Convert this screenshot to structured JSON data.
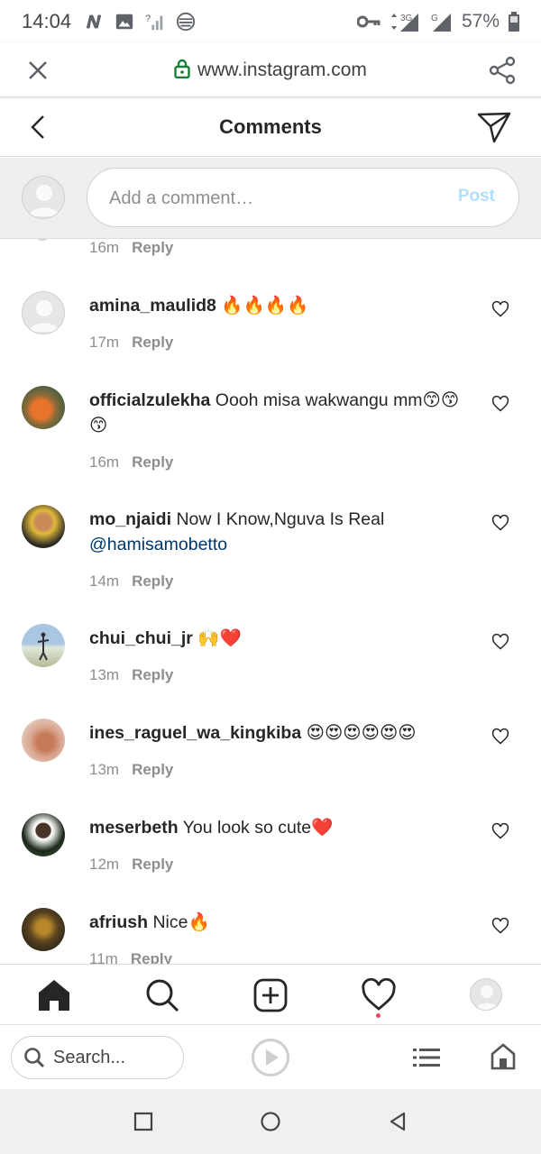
{
  "status_bar": {
    "time": "14:04",
    "network_3g": "3G",
    "network_g": "G",
    "battery": "57%"
  },
  "browser": {
    "url": "www.instagram.com",
    "icons": [
      "close-icon",
      "lock-icon",
      "share-icon"
    ]
  },
  "header": {
    "title": "Comments",
    "icons": [
      "back-arrow-icon",
      "direct-send-icon"
    ]
  },
  "add_comment": {
    "placeholder": "Add a comment…",
    "post_label": "Post",
    "post_color": "#b2dffc"
  },
  "comments": {
    "previous": {
      "time": "16m",
      "reply": "Reply"
    },
    "items": [
      {
        "username": "amina_maulid8",
        "text": "🔥🔥🔥🔥",
        "mention": "",
        "time": "17m",
        "reply": "Reply"
      },
      {
        "username": "officialzulekha",
        "text": "Oooh misa wakwangu mm😙😙😙",
        "mention": "",
        "time": "16m",
        "reply": "Reply"
      },
      {
        "username": "mo_njaidi",
        "text": "Now I Know,Nguva Is Real",
        "mention": "@hamisamobetto",
        "time": "14m",
        "reply": "Reply"
      },
      {
        "username": "chui_chui_jr",
        "text": "🙌❤️",
        "mention": "",
        "time": "13m",
        "reply": "Reply"
      },
      {
        "username": "ines_raguel_wa_kingkiba",
        "text": "😍😍😍😍😍😍",
        "mention": "",
        "time": "13m",
        "reply": "Reply"
      },
      {
        "username": "meserbeth",
        "text": "You look so cute❤️",
        "mention": "",
        "time": "12m",
        "reply": "Reply"
      },
      {
        "username": "afriush",
        "text": "Nice🔥",
        "mention": "",
        "time": "11m",
        "reply": "Reply"
      }
    ]
  },
  "ig_nav": {
    "icons": [
      "home-icon",
      "search-icon",
      "new-post-icon",
      "activity-heart-icon",
      "profile-avatar"
    ],
    "notification_dot_color": "#ed4956"
  },
  "browser_bottom": {
    "search_placeholder": "Search...",
    "icons": [
      "search-icon",
      "play-icon",
      "tabs-menu-icon",
      "home-icon"
    ]
  },
  "android_nav": {
    "icons": [
      "recents-square-icon",
      "home-circle-icon",
      "back-triangle-icon"
    ]
  }
}
